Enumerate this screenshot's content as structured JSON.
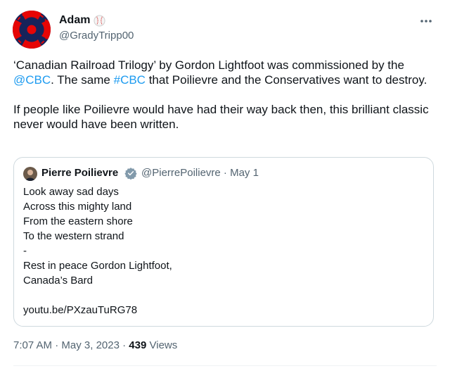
{
  "author": {
    "name": "Adam",
    "handle": "@GradyTripp00",
    "avatar_icon": "cbc-gem-logo-icon",
    "badge_icon": "baseball-icon"
  },
  "tweet": {
    "para1": {
      "t1": "‘Canadian Railroad Trilogy’ by Gordon Lightfoot was commissioned by the ",
      "mention": "@CBC",
      "t2": ". The same ",
      "hashtag": "#CBC",
      "t3": " that Poilievre and the Conservatives want to destroy."
    },
    "para2": "If people like Poilievre would have had their way back then, this brilliant classic never would have been written."
  },
  "quote": {
    "name": "Pierre Poilievre",
    "handle_date": "@PierrePoilievre · May 1",
    "verified_icon": "verified-badge-icon",
    "lines": [
      "Look away sad days",
      "Across this mighty land",
      "From the eastern shore",
      "To the western strand",
      "-",
      "Rest in peace Gordon Lightfoot,",
      "Canada’s Bard",
      "",
      "youtu.be/PXzauTuRG78"
    ]
  },
  "meta": {
    "time": "7:07 AM",
    "date": "May 3, 2023",
    "views_count": "439",
    "views_label": "Views"
  },
  "colors": {
    "link": "#1d9bf0",
    "secondary_text": "#536471",
    "border": "#cfd9de",
    "cbc_red": "#e60505"
  }
}
